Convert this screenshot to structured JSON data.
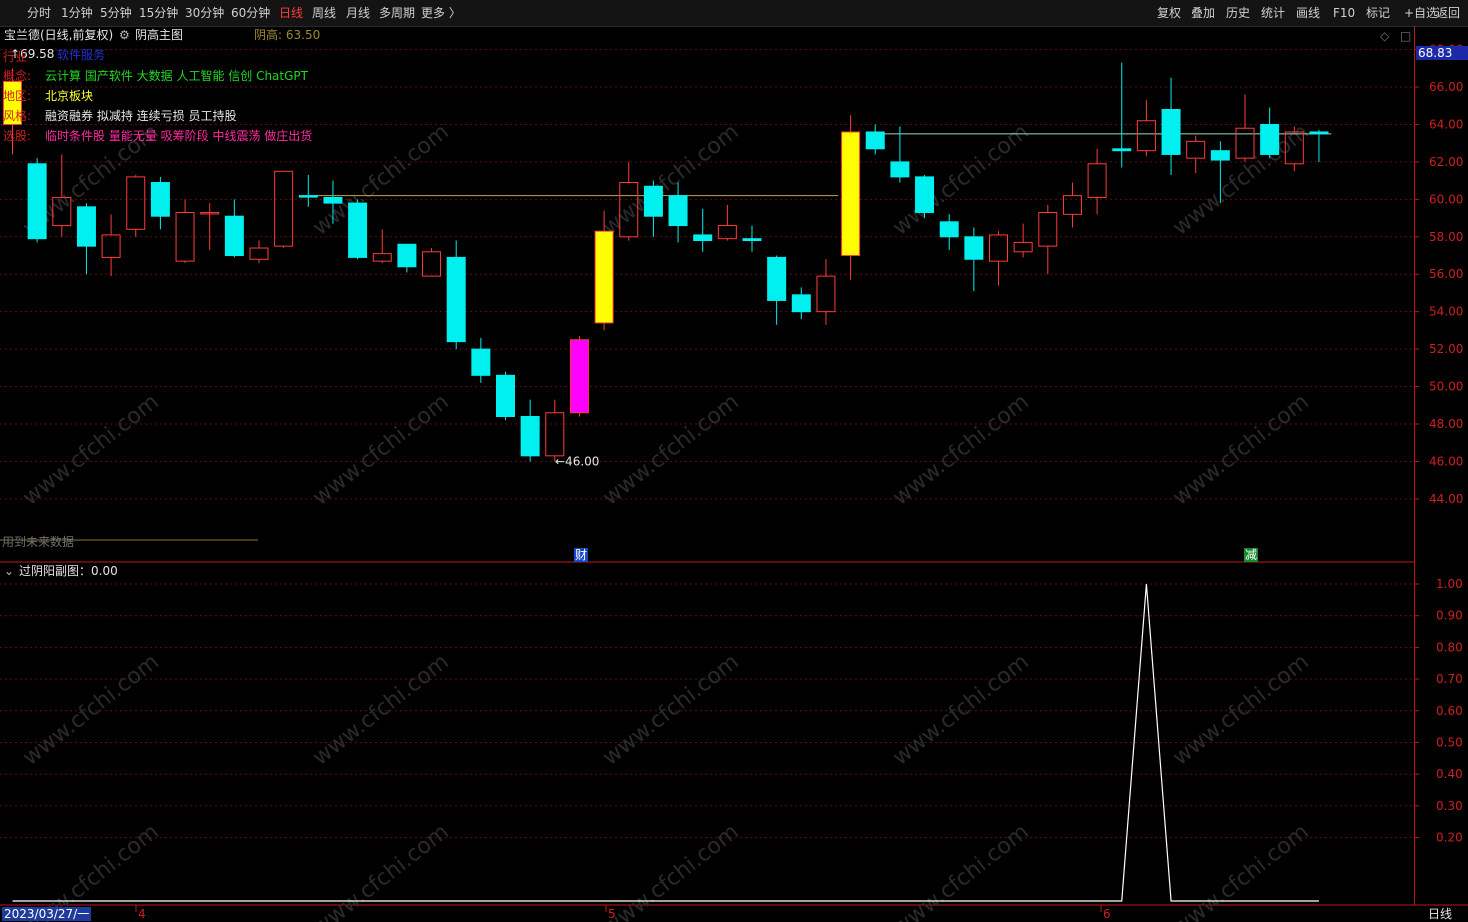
{
  "toolbar": {
    "periods": [
      "分时",
      "1分钟",
      "5分钟",
      "15分钟",
      "30分钟",
      "60分钟",
      "日线",
      "周线",
      "月线",
      "多周期",
      "更多 〉"
    ],
    "active_period": "日线",
    "right_buttons": [
      "复权",
      "叠加",
      "历史",
      "统计",
      "画线",
      "F10",
      "标记",
      "+自选",
      "返回"
    ]
  },
  "main_panel": {
    "stock_title": "宝兰德(日线,前复权)",
    "indicator_name": "阴高主图",
    "yingao_label": "阴高: 63.50",
    "high_marker": "69.58",
    "high_marker_overlay": "软件服务",
    "current_price_tag": "68.83",
    "low_annotation": "←46.00",
    "future_data_warning": "用到未来数据",
    "event_markers": [
      "财",
      "减"
    ],
    "info_rows": [
      {
        "key": "行业",
        "text": ""
      },
      {
        "key": "概念:",
        "text": "云计算 国产软件 大数据 人工智能 信创 ChatGPT"
      },
      {
        "key": "地区:",
        "text": "北京板块"
      },
      {
        "key": "风格:",
        "text": "融资融券 拟减持 连续亏损 员工持股"
      },
      {
        "key": "选股:",
        "text": "临时条件股 量能无量 吸筹阶段 中线震荡 做庄出货"
      }
    ],
    "y_axis_labels": [
      "68.00",
      "66.00",
      "64.00",
      "62.00",
      "60.00",
      "58.00",
      "56.00",
      "54.00",
      "52.00",
      "50.00",
      "48.00",
      "46.00",
      "44.00"
    ]
  },
  "sub_panel": {
    "title": "过阴阳副图：0.00",
    "y_axis_labels": [
      "1.00",
      "0.90",
      "0.80",
      "0.70",
      "0.60",
      "0.50",
      "0.40",
      "0.30",
      "0.20"
    ]
  },
  "bottom_axis": {
    "date_label": "2023/03/27/一",
    "month_labels": [
      "4",
      "5",
      "6"
    ],
    "period_label": "日线"
  },
  "watermark": "www.cfchi.com",
  "colors": {
    "up": "#ff3b3b",
    "down": "#00f0f0",
    "yellow": "#ffff00",
    "magenta": "#ff00ff",
    "axis_red": "#c01818"
  },
  "chart_data": [
    {
      "type": "candlestick",
      "title": "宝兰德(日线,前复权)",
      "ylim": [
        43,
        69.8
      ],
      "y_ticks": [
        44,
        46,
        48,
        50,
        52,
        54,
        56,
        58,
        60,
        62,
        64,
        66,
        68
      ],
      "candles": [
        {
          "o": 64,
          "c": 66.3,
          "h": 67,
          "l": 62.4,
          "style": "yellow"
        },
        {
          "o": 61.9,
          "c": 57.9,
          "h": 62.2,
          "l": 57.7,
          "style": "down"
        },
        {
          "o": 58.6,
          "c": 60.1,
          "h": 62.4,
          "l": 58.0,
          "style": "up"
        },
        {
          "o": 59.6,
          "c": 57.5,
          "h": 59.8,
          "l": 56.0,
          "style": "down"
        },
        {
          "o": 56.9,
          "c": 58.1,
          "h": 59.2,
          "l": 55.9,
          "style": "up"
        },
        {
          "o": 58.4,
          "c": 61.2,
          "h": 61.3,
          "l": 58.0,
          "style": "up"
        },
        {
          "o": 60.9,
          "c": 59.1,
          "h": 61.2,
          "l": 58.4,
          "style": "down"
        },
        {
          "o": 56.7,
          "c": 59.3,
          "h": 60.0,
          "l": 56.6,
          "style": "up"
        },
        {
          "o": 59.3,
          "c": 59.3,
          "h": 59.8,
          "l": 57.3,
          "style": "up"
        },
        {
          "o": 59.1,
          "c": 57.0,
          "h": 60.0,
          "l": 56.9,
          "style": "down"
        },
        {
          "o": 56.8,
          "c": 57.4,
          "h": 57.8,
          "l": 56.6,
          "style": "up"
        },
        {
          "o": 57.5,
          "c": 61.5,
          "h": 61.5,
          "l": 57.4,
          "style": "up"
        },
        {
          "o": 60.2,
          "c": 60.2,
          "h": 61.3,
          "l": 59.6,
          "style": "down"
        },
        {
          "o": 60.1,
          "c": 59.8,
          "h": 61.0,
          "l": 58.7,
          "style": "down"
        },
        {
          "o": 59.8,
          "c": 56.9,
          "h": 60.0,
          "l": 56.8,
          "style": "down"
        },
        {
          "o": 56.7,
          "c": 57.1,
          "h": 58.4,
          "l": 56.6,
          "style": "up"
        },
        {
          "o": 57.6,
          "c": 56.4,
          "h": 57.6,
          "l": 56.1,
          "style": "down"
        },
        {
          "o": 55.9,
          "c": 57.2,
          "h": 57.4,
          "l": 55.9,
          "style": "up"
        },
        {
          "o": 56.9,
          "c": 52.4,
          "h": 57.8,
          "l": 52.0,
          "style": "down"
        },
        {
          "o": 52.0,
          "c": 50.6,
          "h": 52.6,
          "l": 50.2,
          "style": "down"
        },
        {
          "o": 50.6,
          "c": 48.4,
          "h": 50.8,
          "l": 48.2,
          "style": "down"
        },
        {
          "o": 48.4,
          "c": 46.3,
          "h": 49.3,
          "l": 46.0,
          "style": "down"
        },
        {
          "o": 46.3,
          "c": 48.6,
          "h": 49.3,
          "l": 46.0,
          "style": "up"
        },
        {
          "o": 48.6,
          "c": 52.5,
          "h": 52.7,
          "l": 48.4,
          "style": "magenta"
        },
        {
          "o": 53.4,
          "c": 58.3,
          "h": 59.4,
          "l": 53.0,
          "style": "yellow"
        },
        {
          "o": 58.0,
          "c": 60.9,
          "h": 62.0,
          "l": 57.8,
          "style": "up"
        },
        {
          "o": 60.7,
          "c": 59.1,
          "h": 61.0,
          "l": 58.0,
          "style": "down"
        },
        {
          "o": 60.2,
          "c": 58.6,
          "h": 60.9,
          "l": 57.7,
          "style": "down"
        },
        {
          "o": 58.1,
          "c": 57.8,
          "h": 59.5,
          "l": 57.2,
          "style": "down"
        },
        {
          "o": 57.9,
          "c": 58.6,
          "h": 59.7,
          "l": 57.8,
          "style": "up"
        },
        {
          "o": 57.9,
          "c": 57.8,
          "h": 58.6,
          "l": 57.2,
          "style": "down"
        },
        {
          "o": 56.9,
          "c": 54.6,
          "h": 57.0,
          "l": 53.3,
          "style": "down"
        },
        {
          "o": 54.9,
          "c": 54.0,
          "h": 55.3,
          "l": 53.6,
          "style": "down"
        },
        {
          "o": 54.0,
          "c": 55.9,
          "h": 56.8,
          "l": 53.3,
          "style": "up"
        },
        {
          "o": 57.0,
          "c": 63.6,
          "h": 64.5,
          "l": 55.7,
          "style": "yellow"
        },
        {
          "o": 63.6,
          "c": 62.7,
          "h": 64.0,
          "l": 62.4,
          "style": "down"
        },
        {
          "o": 62.0,
          "c": 61.2,
          "h": 63.9,
          "l": 60.9,
          "style": "down"
        },
        {
          "o": 61.2,
          "c": 59.3,
          "h": 61.3,
          "l": 59.0,
          "style": "down"
        },
        {
          "o": 58.8,
          "c": 58.0,
          "h": 59.2,
          "l": 57.3,
          "style": "down"
        },
        {
          "o": 58.0,
          "c": 56.8,
          "h": 58.5,
          "l": 55.1,
          "style": "down"
        },
        {
          "o": 56.7,
          "c": 58.1,
          "h": 58.3,
          "l": 55.4,
          "style": "up"
        },
        {
          "o": 57.2,
          "c": 57.7,
          "h": 58.7,
          "l": 56.9,
          "style": "up"
        },
        {
          "o": 57.5,
          "c": 59.3,
          "h": 59.7,
          "l": 56.0,
          "style": "up"
        },
        {
          "o": 59.2,
          "c": 60.2,
          "h": 60.9,
          "l": 58.5,
          "style": "up"
        },
        {
          "o": 60.1,
          "c": 61.9,
          "h": 62.7,
          "l": 59.2,
          "style": "up"
        },
        {
          "o": 62.7,
          "c": 62.6,
          "h": 67.3,
          "l": 61.7,
          "style": "down"
        },
        {
          "o": 62.6,
          "c": 64.2,
          "h": 65.3,
          "l": 62.3,
          "style": "up"
        },
        {
          "o": 64.8,
          "c": 62.4,
          "h": 66.5,
          "l": 61.3,
          "style": "down"
        },
        {
          "o": 62.2,
          "c": 63.1,
          "h": 63.4,
          "l": 61.4,
          "style": "up"
        },
        {
          "o": 62.6,
          "c": 62.1,
          "h": 63.1,
          "l": 59.8,
          "style": "down"
        },
        {
          "o": 62.2,
          "c": 63.8,
          "h": 65.6,
          "l": 62.0,
          "style": "up"
        },
        {
          "o": 64.0,
          "c": 62.4,
          "h": 64.9,
          "l": 62.2,
          "style": "down"
        },
        {
          "o": 61.9,
          "c": 63.6,
          "h": 63.9,
          "l": 61.5,
          "style": "up"
        },
        {
          "o": 63.5,
          "c": 63.6,
          "h": 63.7,
          "l": 62.0,
          "style": "down"
        }
      ],
      "ref_lines": [
        {
          "y": 60.2,
          "from": 12,
          "to": 33,
          "color": "#c8a24a"
        },
        {
          "y": 63.5,
          "from": 35,
          "to": 53,
          "color": "#9ed9b8"
        }
      ]
    },
    {
      "type": "line",
      "title": "过阴阳副图：0.00",
      "ylim": [
        0,
        1.05
      ],
      "y_ticks": [
        0.2,
        0.3,
        0.4,
        0.5,
        0.6,
        0.7,
        0.8,
        0.9,
        1.0
      ],
      "values": [
        0,
        0,
        0,
        0,
        0,
        0,
        0,
        0,
        0,
        0,
        0,
        0,
        0,
        0,
        0,
        0,
        0,
        0,
        0,
        0,
        0,
        0,
        0,
        0,
        0,
        0,
        0,
        0,
        0,
        0,
        0,
        0,
        0,
        0,
        0,
        0,
        0,
        0,
        0,
        0,
        0,
        0,
        0,
        0,
        0,
        0,
        1,
        0,
        0,
        0,
        0,
        0,
        0,
        0
      ]
    }
  ]
}
